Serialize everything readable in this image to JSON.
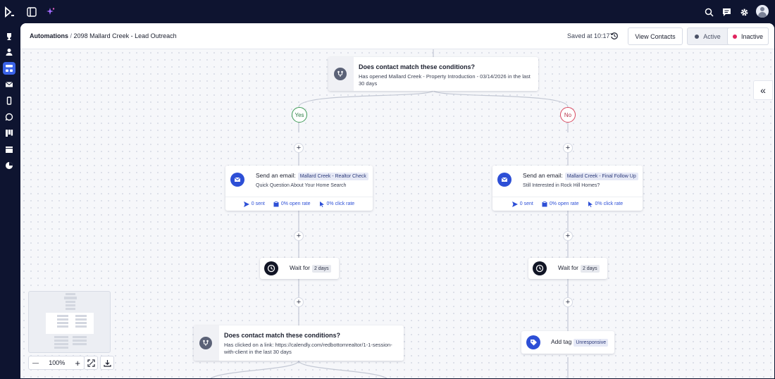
{
  "header": {
    "breadcrumb_root": "Automations",
    "breadcrumb_sep": "/",
    "breadcrumb_current": "2098 Mallard Creek - Lead Outreach",
    "saved_text": "Saved at 10:17",
    "view_contacts": "View Contacts",
    "status_active": "Active",
    "status_inactive": "Inactive",
    "status_selected": "Inactive"
  },
  "colors": {
    "active_dot": "#4a5166",
    "inactive_dot": "#e0245e",
    "accent": "#2d4fd6",
    "nav_bg": "#0e1430"
  },
  "topbar_icons": [
    "logo-icon",
    "sidebar-toggle-icon",
    "ai-sparkle-icon",
    "search-icon",
    "chat-icon",
    "gear-icon",
    "avatar"
  ],
  "rail_icons": [
    "trophy-icon",
    "contacts-icon",
    "automations-icon",
    "mail-icon",
    "mobile-icon",
    "whatsapp-icon",
    "board-icon",
    "calendar-icon",
    "chart-icon"
  ],
  "flow": {
    "condition_1": {
      "title": "Does contact match these conditions?",
      "desc": "Has opened Mallard Creek - Property Introduction - 03/14/2026 in the last 30 days"
    },
    "branch_yes": "Yes",
    "branch_no": "No",
    "email_left": {
      "prefix": "Send an email:",
      "template": "Mallard Creek - Realtor Check",
      "subject": "Quick Question About Your Home Search",
      "sent": "0 sent",
      "open_rate": "0% open rate",
      "click_rate": "0% click rate"
    },
    "email_right": {
      "prefix": "Send an email:",
      "template": "Mallard Creek - Final Follow Up",
      "subject": "Still Interested in Rock Hill Homes?",
      "sent": "0 sent",
      "open_rate": "0% open rate",
      "click_rate": "0% click rate"
    },
    "wait_left": {
      "label": "Wait for",
      "value": "2 days"
    },
    "wait_right": {
      "label": "Wait for",
      "value": "2 days"
    },
    "condition_2": {
      "title": "Does contact match these conditions?",
      "desc": "Has clicked on a link: https://calendly.com/redbottomrealtor/1-1-session-with-client in the last 30 days"
    },
    "add_tag": {
      "label": "Add tag",
      "value": "Unresponsive"
    },
    "plus": "+"
  },
  "controls": {
    "zoom": "100%",
    "zoom_out": "—",
    "zoom_in": "+",
    "collapse": "«"
  }
}
